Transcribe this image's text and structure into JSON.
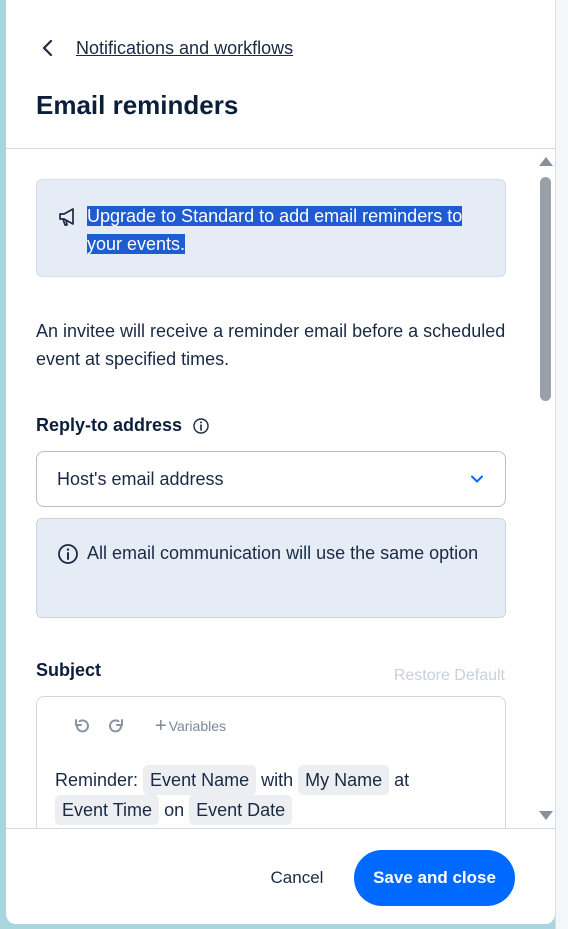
{
  "header": {
    "back_link": "Notifications and workflows",
    "title": "Email reminders"
  },
  "upgrade_banner": {
    "icon": "megaphone-icon",
    "text": "Upgrade to Standard to add email reminders to your events."
  },
  "description": "An invitee will receive a reminder email before a scheduled event at specified times.",
  "reply_to": {
    "label": "Reply-to address",
    "selected": "Host's email address",
    "note": "All email communication will use the same option"
  },
  "subject": {
    "label": "Subject",
    "restore_default": "Restore Default",
    "variables_label": "Variables",
    "parts": {
      "prefix": "Reminder:",
      "chip1": "Event Name",
      "w1": "with",
      "chip2": "My Name",
      "w2": "at",
      "chip3": "Event Time",
      "w3": "on",
      "chip4": "Event Date"
    }
  },
  "footer": {
    "cancel_label": "Cancel",
    "save_label": "Save and close"
  },
  "colors": {
    "primary": "#0069ff",
    "selection": "#1f5bd1",
    "banner_bg": "#e5ecf6"
  }
}
